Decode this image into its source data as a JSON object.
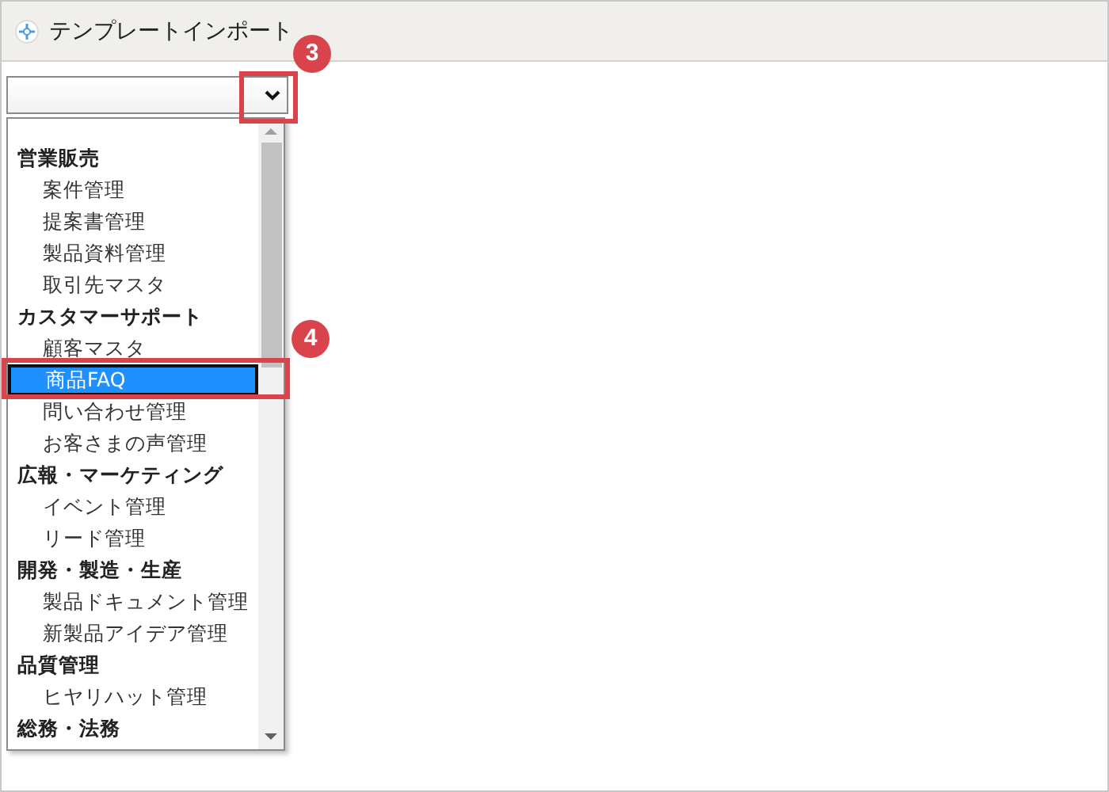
{
  "header": {
    "title": "テンプレートインポート"
  },
  "dropdown": {
    "groups": [
      {
        "label": "営業販売",
        "selected": false,
        "children": [
          {
            "label": "案件管理",
            "selected": false
          },
          {
            "label": "提案書管理",
            "selected": false
          },
          {
            "label": "製品資料管理",
            "selected": false
          },
          {
            "label": "取引先マスタ",
            "selected": false
          }
        ]
      },
      {
        "label": "カスタマーサポート",
        "selected": false,
        "children": [
          {
            "label": "顧客マスタ",
            "selected": false
          },
          {
            "label": "商品FAQ",
            "selected": true
          },
          {
            "label": "問い合わせ管理",
            "selected": false
          },
          {
            "label": "お客さまの声管理",
            "selected": false
          }
        ]
      },
      {
        "label": "広報・マーケティング",
        "selected": false,
        "children": [
          {
            "label": "イベント管理",
            "selected": false
          },
          {
            "label": "リード管理",
            "selected": false
          }
        ]
      },
      {
        "label": "開発・製造・生産",
        "selected": false,
        "children": [
          {
            "label": "製品ドキュメント管理",
            "selected": false
          },
          {
            "label": "新製品アイデア管理",
            "selected": false
          }
        ]
      },
      {
        "label": "品質管理",
        "selected": false,
        "children": [
          {
            "label": "ヒヤリハット管理",
            "selected": false
          }
        ]
      },
      {
        "label": "総務・法務",
        "selected": false
      }
    ]
  },
  "callouts": [
    {
      "number": "3"
    },
    {
      "number": "4"
    }
  ]
}
